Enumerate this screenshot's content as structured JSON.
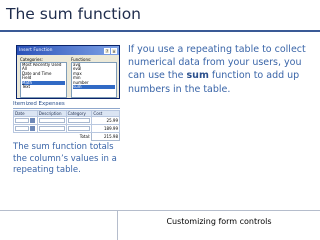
{
  "slide": {
    "title": "The sum function",
    "body_before": "If you use a repeating table to collect numerical data from your users, you can use the ",
    "body_bold": "sum",
    "body_after": " function to add up numbers in the table.",
    "caption": "The sum function totals the column’s values in a repeating table.",
    "footer": "Customizing form controls"
  },
  "dialog": {
    "title": "Insert Function",
    "categories_label": "Categories:",
    "categories": [
      "Most Recently Used",
      "All",
      "Date and Time",
      "Field",
      "Math",
      "Text"
    ],
    "selected_category_index": 4,
    "functions_label": "Functions:",
    "functions": [
      "avg",
      "eval",
      "max",
      "min",
      "number",
      "sum"
    ],
    "selected_function_index": 5,
    "close_glyph": "×",
    "help_glyph": "?"
  },
  "table": {
    "heading": "Itemized Expenses",
    "columns": [
      "Date",
      "Description",
      "Category",
      "Cost"
    ],
    "rows": [
      {
        "cost": "25.99"
      },
      {
        "cost": "189.99"
      }
    ],
    "total_label": "Total:",
    "total_value": "215.98"
  }
}
